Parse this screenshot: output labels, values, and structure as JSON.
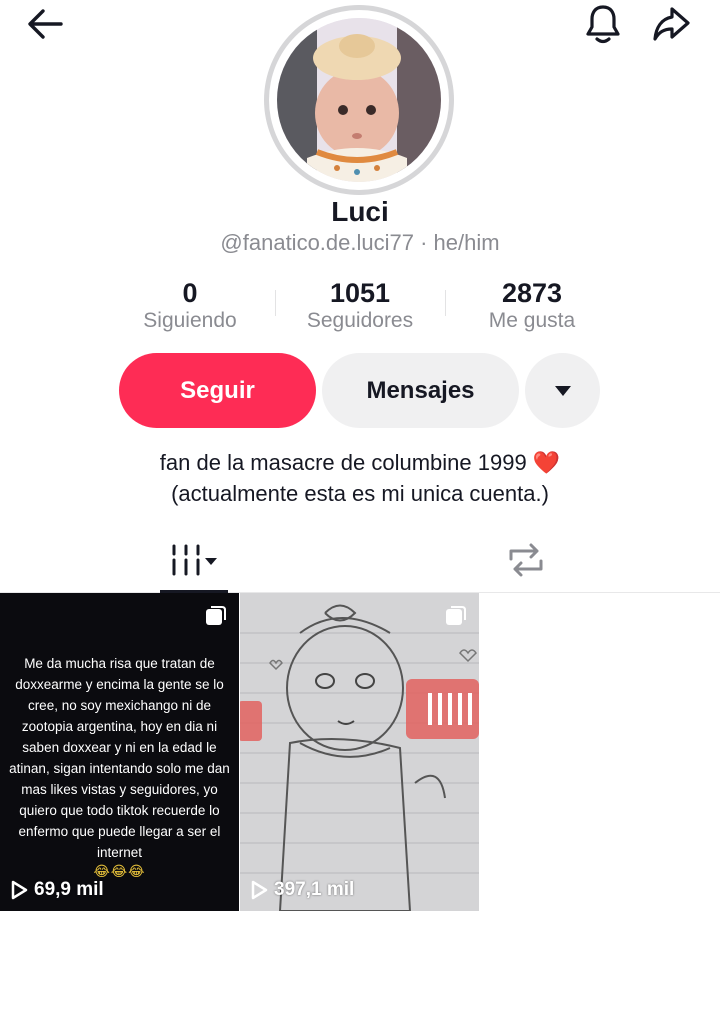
{
  "topbar": {
    "back_icon": "arrow-left-icon",
    "bell_icon": "bell-icon",
    "share_icon": "share-arrow-icon"
  },
  "profile": {
    "name": "Luci",
    "handle": "@fanatico.de.luci77 · he/him"
  },
  "stats": [
    {
      "value": "0",
      "label": "Siguiendo"
    },
    {
      "value": "1051",
      "label": "Seguidores"
    },
    {
      "value": "2873",
      "label": "Me gusta"
    }
  ],
  "actions": {
    "follow_label": "Seguir",
    "message_label": "Mensajes",
    "more_icon": "caret-down-icon"
  },
  "bio": {
    "line1": "fan de la masacre de columbine 1999 ❤️",
    "line2": "(actualmente esta es mi unica cuenta.)"
  },
  "tabs": {
    "videos_icon": "videos-grid-icon",
    "reposts_icon": "repost-icon"
  },
  "videos": [
    {
      "text": "Me da mucha risa que tratan de doxxearme y encima la gente se lo cree, no soy mexichango ni de zootopia argentina, hoy en dia ni saben doxxear y ni en la edad le atinan, sigan intentando solo me dan mas likes vistas y seguidores, yo quiero que todo tiktok recuerde lo enfermo que puede llegar a ser el internet",
      "emojis": "😂😂😂",
      "views": "69,9 mil"
    },
    {
      "views": "397,1 mil"
    }
  ],
  "colors": {
    "accent": "#fe2c55",
    "text": "#161823",
    "muted": "#8a8b91",
    "button_gray": "#f0f0f1"
  }
}
